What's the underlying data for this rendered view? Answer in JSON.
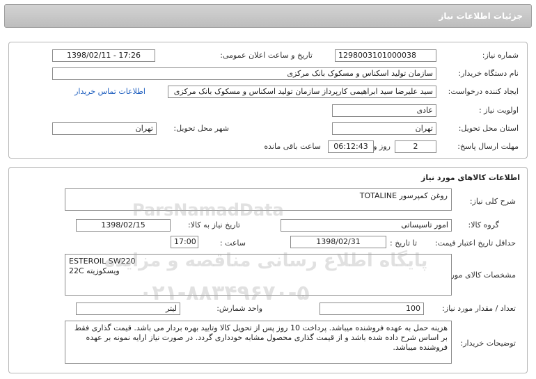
{
  "header": {
    "title": "جزئیات اطلاعات نیاز"
  },
  "need_info": {
    "need_number_label": "شماره نیاز:",
    "need_number": "1298003101000038",
    "announce_label": "تاریخ و ساعت اعلان عمومی:",
    "announce_value": "1398/02/11 - 17:26",
    "buyer_org_label": "نام دستگاه خریدار:",
    "buyer_org": "سازمان تولید اسکناس و مسکوک بانک مرکزی",
    "requester_label": "ایجاد کننده درخواست:",
    "requester": "سید علیرضا سید ابراهیمی کارپرداز سازمان تولید اسکناس و مسکوک بانک مرکزی",
    "contact_link": "اطلاعات تماس خریدار",
    "priority_label": "اولویت نیاز :",
    "priority": "عادی",
    "province_label": "استان محل تحویل:",
    "province": "تهران",
    "city_label": "شهر محل تحویل:",
    "city": "تهران",
    "deadline_label": "مهلت ارسال پاسخ:",
    "deadline_days": "2",
    "deadline_days_label": "روز و",
    "deadline_time": "06:12:43",
    "deadline_remaining_label": "ساعت باقی مانده"
  },
  "goods": {
    "section_title": "اطلاعات کالاهای مورد نیاز",
    "summary_label": "شرح کلی نیاز:",
    "summary": "روغن کمپرسور TOTALINE",
    "group_label": "گروه کالا:",
    "group": "امور تاسیساتی",
    "need_date_label": "تاریخ نیاز به کالا:",
    "need_date": "1398/02/15",
    "validity_label": "حداقل تاریخ اعتبار قیمت:",
    "to_date_label": "تا تاریخ :",
    "to_date": "1398/02/31",
    "time_label": "ساعت :",
    "time": "17:00",
    "specs_label": "مشخصات کالای مورد نیاز:",
    "specs_line1": "ESTEROIL SW220",
    "specs_line2": "ویسکوزیته 22C",
    "qty_label": "تعداد / مقدار مورد نیاز:",
    "qty": "100",
    "unit_label": "واحد شمارش:",
    "unit": "لیتر",
    "buyer_notes_label": "توضیحات خریدار:",
    "buyer_notes": "هزینه حمل به عهده فروشنده میباشد. پرداخت 10 روز پس از تحویل کالا وتایید بهره بردار می باشد. قیمت گذاری فقط بر اساس شرح داده شده باشد و از قیمت گذاری محصول مشابه خودداری گردد. در صورت نیاز ارایه نمونه بر عهده فروشنده میباشد."
  },
  "watermark": {
    "brand": "ParsNamadData",
    "line1": "پایگاه اطلاع رسانی مناقصه و مزایده",
    "line2": "۰۲۱-۸۸۳۴۹۶۷۰-۵"
  }
}
